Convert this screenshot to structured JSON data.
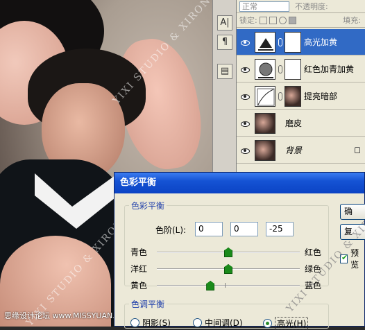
{
  "photo": {
    "watermark": "YIXI STUDIO & XIRONG",
    "corner_label": "思缘设计论坛 www.MISSYUAN.COM"
  },
  "toolstrip": {
    "buttons": [
      "A|",
      "¶",
      "▤"
    ]
  },
  "layers_panel": {
    "blend_mode": "正常",
    "opacity_label": "不透明度:",
    "lock_label": "锁定:",
    "fill_label": "填充:",
    "layers": [
      {
        "name": "高光加黄",
        "type": "adjustment",
        "selected": true,
        "italic": false,
        "locked": false
      },
      {
        "name": "红色加青加黄",
        "type": "adjustment",
        "selected": false,
        "italic": false,
        "locked": false
      },
      {
        "name": "提亮暗部",
        "type": "adjustment",
        "selected": false,
        "italic": false,
        "locked": false
      },
      {
        "name": "磨皮",
        "type": "photo",
        "selected": false,
        "italic": false,
        "locked": false
      },
      {
        "name": "背景",
        "type": "photo",
        "selected": false,
        "italic": true,
        "locked": true
      }
    ]
  },
  "dialog": {
    "title": "色彩平衡",
    "balance_group": {
      "title": "色彩平衡",
      "levels_label": "色阶(L):",
      "levels": [
        "0",
        "0",
        "-25"
      ],
      "sliders": [
        {
          "left": "青色",
          "right": "红色",
          "value": 0
        },
        {
          "left": "洋红",
          "right": "绿色",
          "value": 0
        },
        {
          "left": "黄色",
          "right": "蓝色",
          "value": -25
        }
      ]
    },
    "tone_group": {
      "title": "色调平衡",
      "options": [
        "阴影(S)",
        "中间调(D)",
        "高光(H)"
      ],
      "selected": "高光(H)"
    },
    "buttons": {
      "ok": "确",
      "reset": "复"
    },
    "preview_label": "预览"
  }
}
